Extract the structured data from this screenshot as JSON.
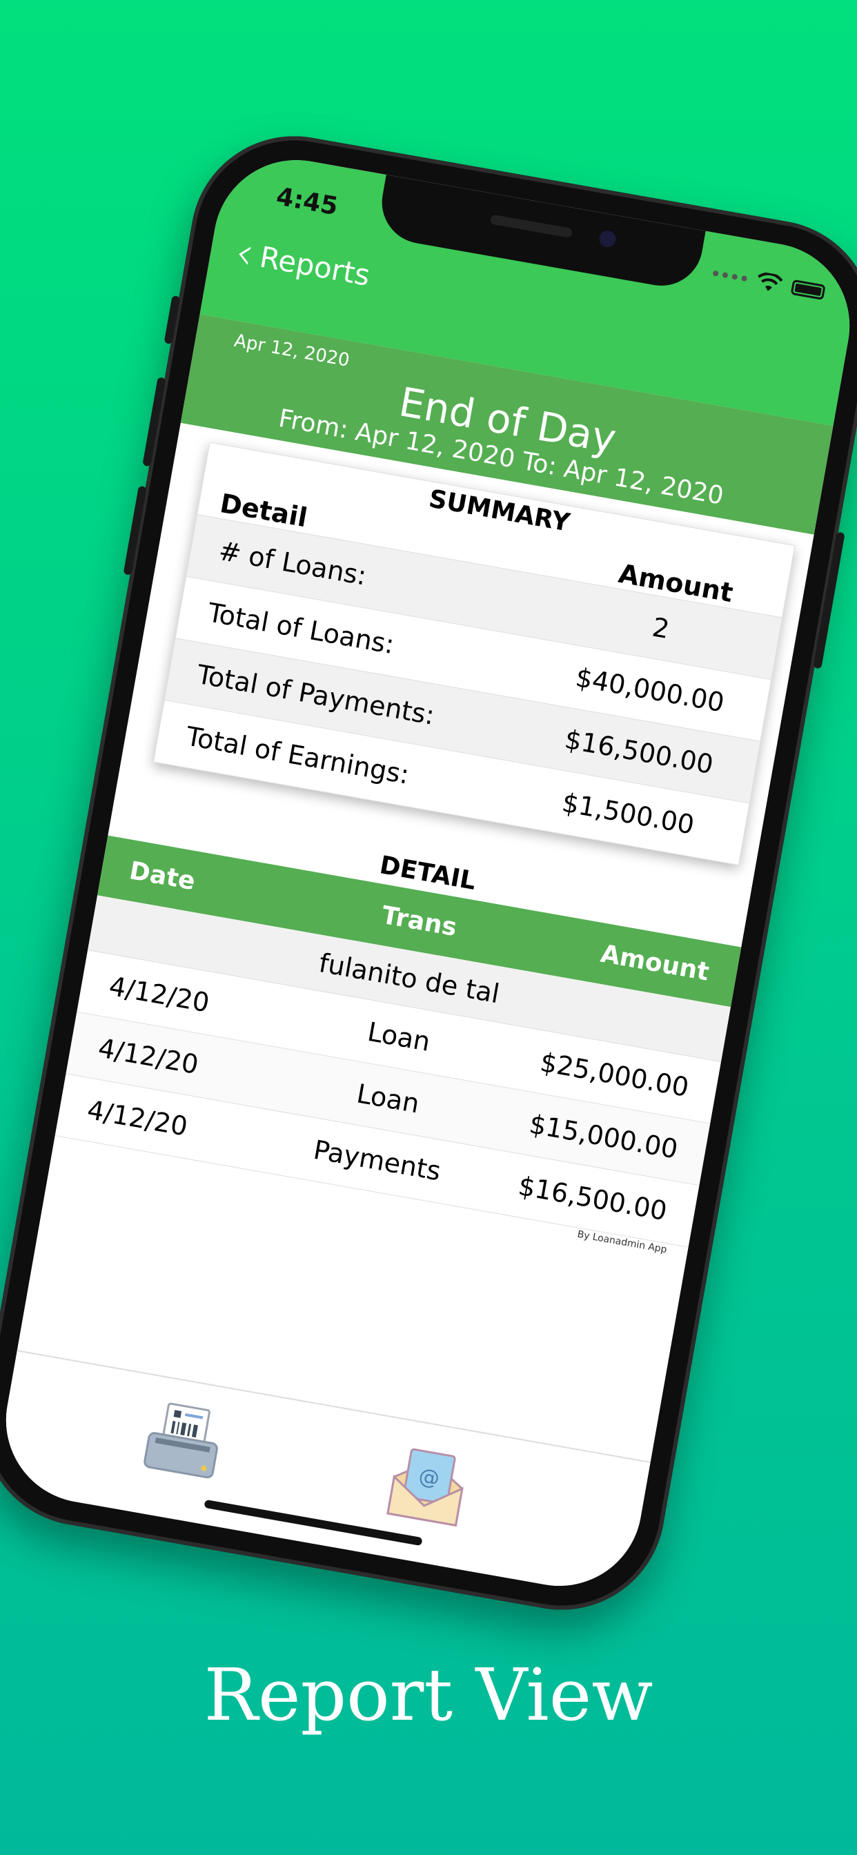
{
  "status": {
    "time": "4:45"
  },
  "nav": {
    "back_label": "Reports"
  },
  "report": {
    "date": "Apr 12, 2020",
    "title": "End of Day",
    "range": "From: Apr 12, 2020 To: Apr 12, 2020"
  },
  "summary": {
    "title": "SUMMARY",
    "headers": {
      "detail": "Detail",
      "amount": "Amount"
    },
    "rows": [
      {
        "label": "# of Loans:",
        "value": "2"
      },
      {
        "label": "Total of Loans:",
        "value": "$40,000.00"
      },
      {
        "label": "Total of Payments:",
        "value": "$16,500.00"
      },
      {
        "label": "Total of Earnings:",
        "value": "$1,500.00"
      }
    ]
  },
  "detail": {
    "title": "DETAIL",
    "headers": {
      "date": "Date",
      "trans": "Trans",
      "amount": "Amount"
    },
    "client": "fulanito de tal",
    "rows": [
      {
        "date": "4/12/20",
        "trans": "Loan",
        "amount": "$25,000.00"
      },
      {
        "date": "4/12/20",
        "trans": "Loan",
        "amount": "$15,000.00"
      },
      {
        "date": "4/12/20",
        "trans": "Payments",
        "amount": "$16,500.00"
      }
    ]
  },
  "footer": {
    "credit": "By Loanadmin App"
  },
  "caption": "Report View",
  "colors": {
    "nav_green": "#3cc957",
    "header_green": "#55ae52",
    "background": "#00d488"
  }
}
